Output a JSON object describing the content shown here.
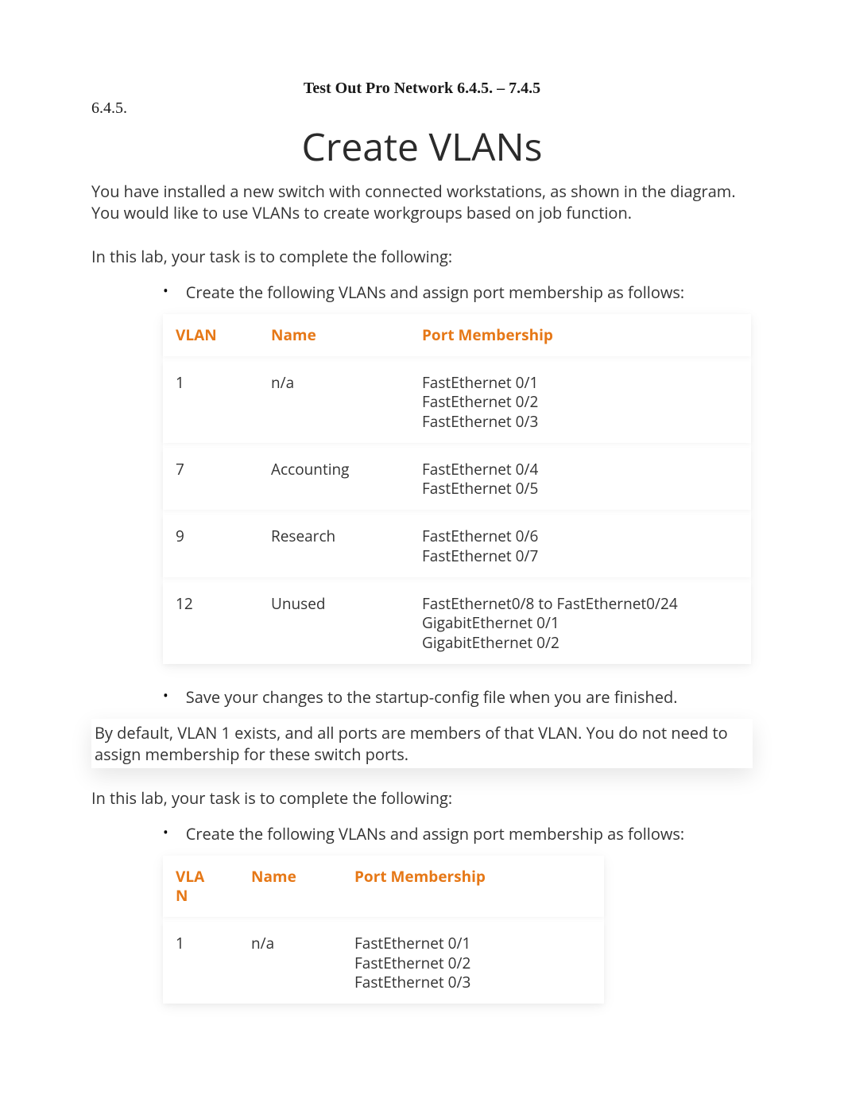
{
  "header": {
    "title": "Test Out Pro Network 6.4.5. – 7.4.5",
    "section_number": "6.4.5."
  },
  "main": {
    "title": "Create VLANs",
    "intro": "You have installed a new switch with connected workstations, as shown in the diagram. You would like to use VLANs to create workgroups based on job function.",
    "task_intro_1": "In this lab, your task is to complete the following:",
    "bullet_create_1": "Create the following VLANs and assign port membership as follows:",
    "table1": {
      "headers": {
        "vlan": "VLAN",
        "name": "Name",
        "port": "Port Membership"
      },
      "rows": [
        {
          "vlan": "1",
          "name": "n/a",
          "port": "FastEthernet 0/1\nFastEthernet 0/2\nFastEthernet 0/3"
        },
        {
          "vlan": "7",
          "name": "Accounting",
          "port": "FastEthernet 0/4\nFastEthernet 0/5"
        },
        {
          "vlan": "9",
          "name": "Research",
          "port": "FastEthernet 0/6\nFastEthernet 0/7"
        },
        {
          "vlan": "12",
          "name": "Unused",
          "port": "FastEthernet0/8 to FastEthernet0/24\nGigabitEthernet 0/1\nGigabitEthernet 0/2"
        }
      ]
    },
    "bullet_save": "Save your changes to the startup-config file when you are finished.",
    "note": "By default, VLAN 1 exists, and all ports are members of that VLAN. You do not need to assign membership for these switch ports.",
    "task_intro_2": "In this lab, your task is to complete the following:",
    "bullet_create_2": "Create the following VLANs and assign port membership as follows:",
    "table2": {
      "headers": {
        "vlan": "VLA\nN",
        "name": "Name",
        "port": "Port Membership"
      },
      "rows": [
        {
          "vlan": "1",
          "name": "n/a",
          "port": "FastEthernet 0/1\nFastEthernet 0/2\nFastEthernet 0/3"
        }
      ]
    }
  }
}
